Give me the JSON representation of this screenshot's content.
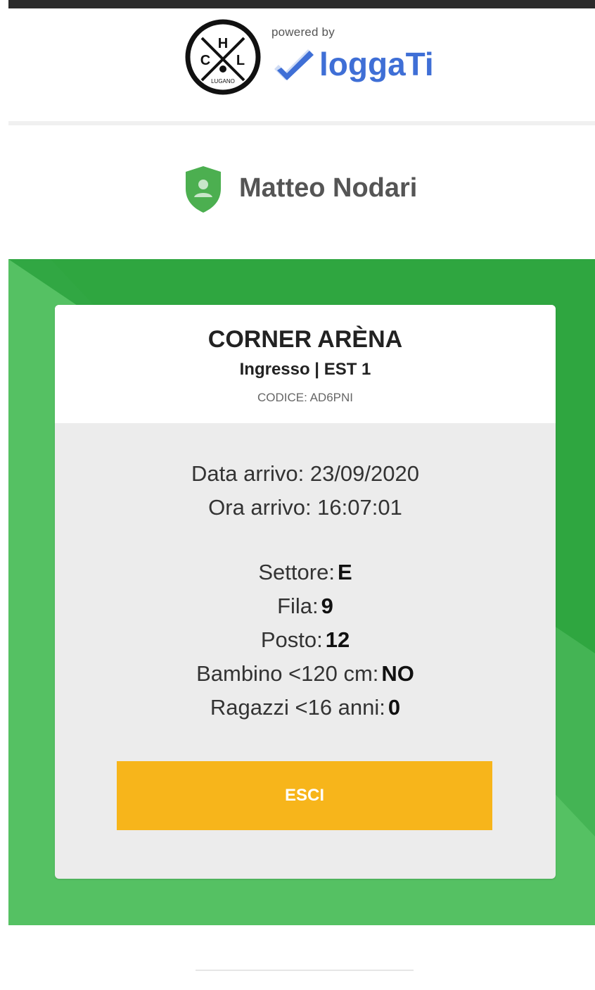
{
  "header": {
    "club_logo_letters": [
      "H",
      "C",
      "L"
    ],
    "club_logo_text": "LUGANO",
    "powered_by": "powered by",
    "brand_name": "loggaTi"
  },
  "user": {
    "name": "Matteo Nodari",
    "icon": "shield-user-icon"
  },
  "ticket": {
    "venue": "CORNER ARÈNA",
    "entrance": "Ingresso | EST 1",
    "code": "CODICE: AD6PNI",
    "arrival_date": "Data arrivo: 23/09/2020",
    "arrival_time": "Ora arrivo: 16:07:01",
    "sector_label": "Settore:",
    "sector_value": "E",
    "row_label": "Fila:",
    "row_value": "9",
    "seat_label": "Posto:",
    "seat_value": "12",
    "child_label": "Bambino <120 cm:",
    "child_value": "NO",
    "kids_label": "Ragazzi <16 anni:",
    "kids_value": "0"
  },
  "actions": {
    "exit_label": "ESCI"
  },
  "colors": {
    "panel_green": "#3aaa48",
    "shield_green": "#4caf50",
    "button_yellow": "#f7b51b",
    "brand_blue": "#3f6fd6"
  }
}
